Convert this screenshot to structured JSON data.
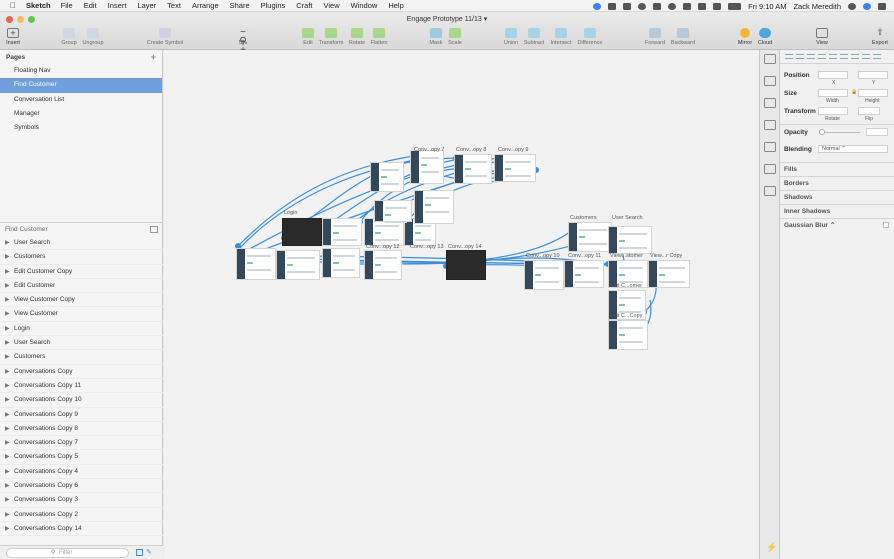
{
  "menubar": {
    "app": "Sketch",
    "items": [
      "File",
      "Edit",
      "Insert",
      "Layer",
      "Text",
      "Arrange",
      "Share",
      "Plugins",
      "Craft",
      "View",
      "Window",
      "Help"
    ],
    "clock": "Fri 9:10 AM",
    "user": "Zack Meredith"
  },
  "window": {
    "title": "Engage Prototype 11/13 ▾"
  },
  "toolbar": {
    "insert": "Insert",
    "group": "Group",
    "ungroup": "Ungroup",
    "create_symbol": "Create Symbol",
    "zoom": "5%",
    "edit": "Edit",
    "transform": "Transform",
    "rotate": "Rotate",
    "flatten": "Flatten",
    "mask": "Mask",
    "scale": "Scale",
    "union": "Union",
    "subtract": "Subtract",
    "intersect": "Intersect",
    "difference": "Difference",
    "forward": "Forward",
    "backward": "Backward",
    "mirror": "Mirror",
    "cloud": "Cloud",
    "view": "View",
    "export": "Export"
  },
  "pages": {
    "header": "Pages",
    "items": [
      "Floating Nav",
      "Find Customer",
      "Conversation List",
      "Manager",
      "Symbols"
    ],
    "selected": "Find Customer"
  },
  "layers": {
    "header": "Find Customer",
    "items": [
      "User Search",
      "Customers",
      "Edit Customer Copy",
      "Edit Customer",
      "View Customer Copy",
      "View Customer",
      "Login",
      "User Search",
      "Customers",
      "Conversations Copy",
      "Conversations Copy 11",
      "Conversations Copy 10",
      "Conversations Copy 9",
      "Conversations Copy 8",
      "Conversations Copy 7",
      "Conversations Copy 5",
      "Conversations Copy 4",
      "Conversations Copy 6",
      "Conversations Copy 3",
      "Conversations Copy 2",
      "Conversations Copy 14"
    ],
    "filter_placeholder": "Filter"
  },
  "canvas": {
    "artboard_labels": [
      "Login",
      "Conv...opy 7",
      "Conv...opy 8",
      "Conv...opy 9",
      "Conv...opy 12",
      "Conv...opy 13",
      "Conv...opy 14",
      "Customers",
      "User Search",
      "Conv...opy 10",
      "Conv...opy 11",
      "View...stomer",
      "View...r Copy",
      "Edit C...omer",
      "Edit C...Copy"
    ]
  },
  "inspector": {
    "position": "Position",
    "x": "X",
    "y": "Y",
    "size": "Size",
    "width": "Width",
    "height": "Height",
    "transform": "Transform",
    "rotate": "Rotate",
    "flip": "Flip",
    "opacity": "Opacity",
    "blending": "Blending",
    "blending_value": "Normal ⌃",
    "fills": "Fills",
    "borders": "Borders",
    "shadows": "Shadows",
    "inner_shadows": "Inner Shadows",
    "gaussian_blur": "Gaussian Blur ⌃"
  },
  "colors": {
    "accent": "#6fa0dc",
    "prototype_link": "#3b8fd9"
  }
}
